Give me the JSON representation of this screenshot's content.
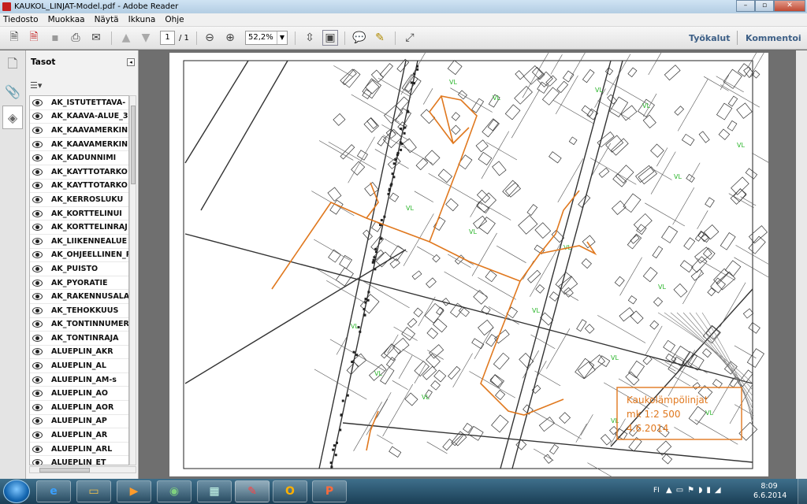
{
  "window": {
    "title": "KAUKOL_LINJAT-Model.pdf - Adobe Reader",
    "min": "–",
    "max": "▫",
    "close": "✕"
  },
  "menu": [
    "Tiedosto",
    "Muokkaa",
    "Näytä",
    "Ikkuna",
    "Ohje"
  ],
  "toolbar": {
    "page_current": "1",
    "page_total": "/ 1",
    "zoom": "52,2%",
    "tools": "Työkalut",
    "comment": "Kommentoi"
  },
  "panel": {
    "title": "Tasot"
  },
  "layers": [
    "AK_ISTUTETTAVA-",
    "AK_KAAVA-ALUE_3",
    "AK_KAAVAMERKIN",
    "AK_KAAVAMERKIN",
    "AK_KADUNNIMI",
    "AK_KAYTTOTARKO",
    "AK_KAYTTOTARKO",
    "AK_KERROSLUKU",
    "AK_KORTTELINUI",
    "AK_KORTTELINRAJ",
    "AK_LIIKENNEALUE",
    "AK_OHJEELLINEN_R",
    "AK_PUISTO",
    "AK_PYORATIE",
    "AK_RAKENNUSALA",
    "AK_TEHOKKUUS",
    "AK_TONTINNUMER",
    "AK_TONTINRAJA",
    "ALUEPLIN_AKR",
    "ALUEPLIN_AL",
    "ALUEPLIN_AM-s",
    "ALUEPLIN_AO",
    "ALUEPLIN_AOR",
    "ALUEPLIN_AP",
    "ALUEPLIN_AR",
    "ALUEPLIN_ARL",
    "ALUEPLIN_ET"
  ],
  "map": {
    "legend_line1": "Kaukolämpölinjat",
    "legend_line2": "mk  1:2  500",
    "legend_line3": "4.6.2014",
    "line_color": "#e0781e",
    "label_color": "#2bb52b"
  },
  "taskbar": {
    "lang": "FI",
    "time": "8:09",
    "date": "6.6.2014"
  }
}
